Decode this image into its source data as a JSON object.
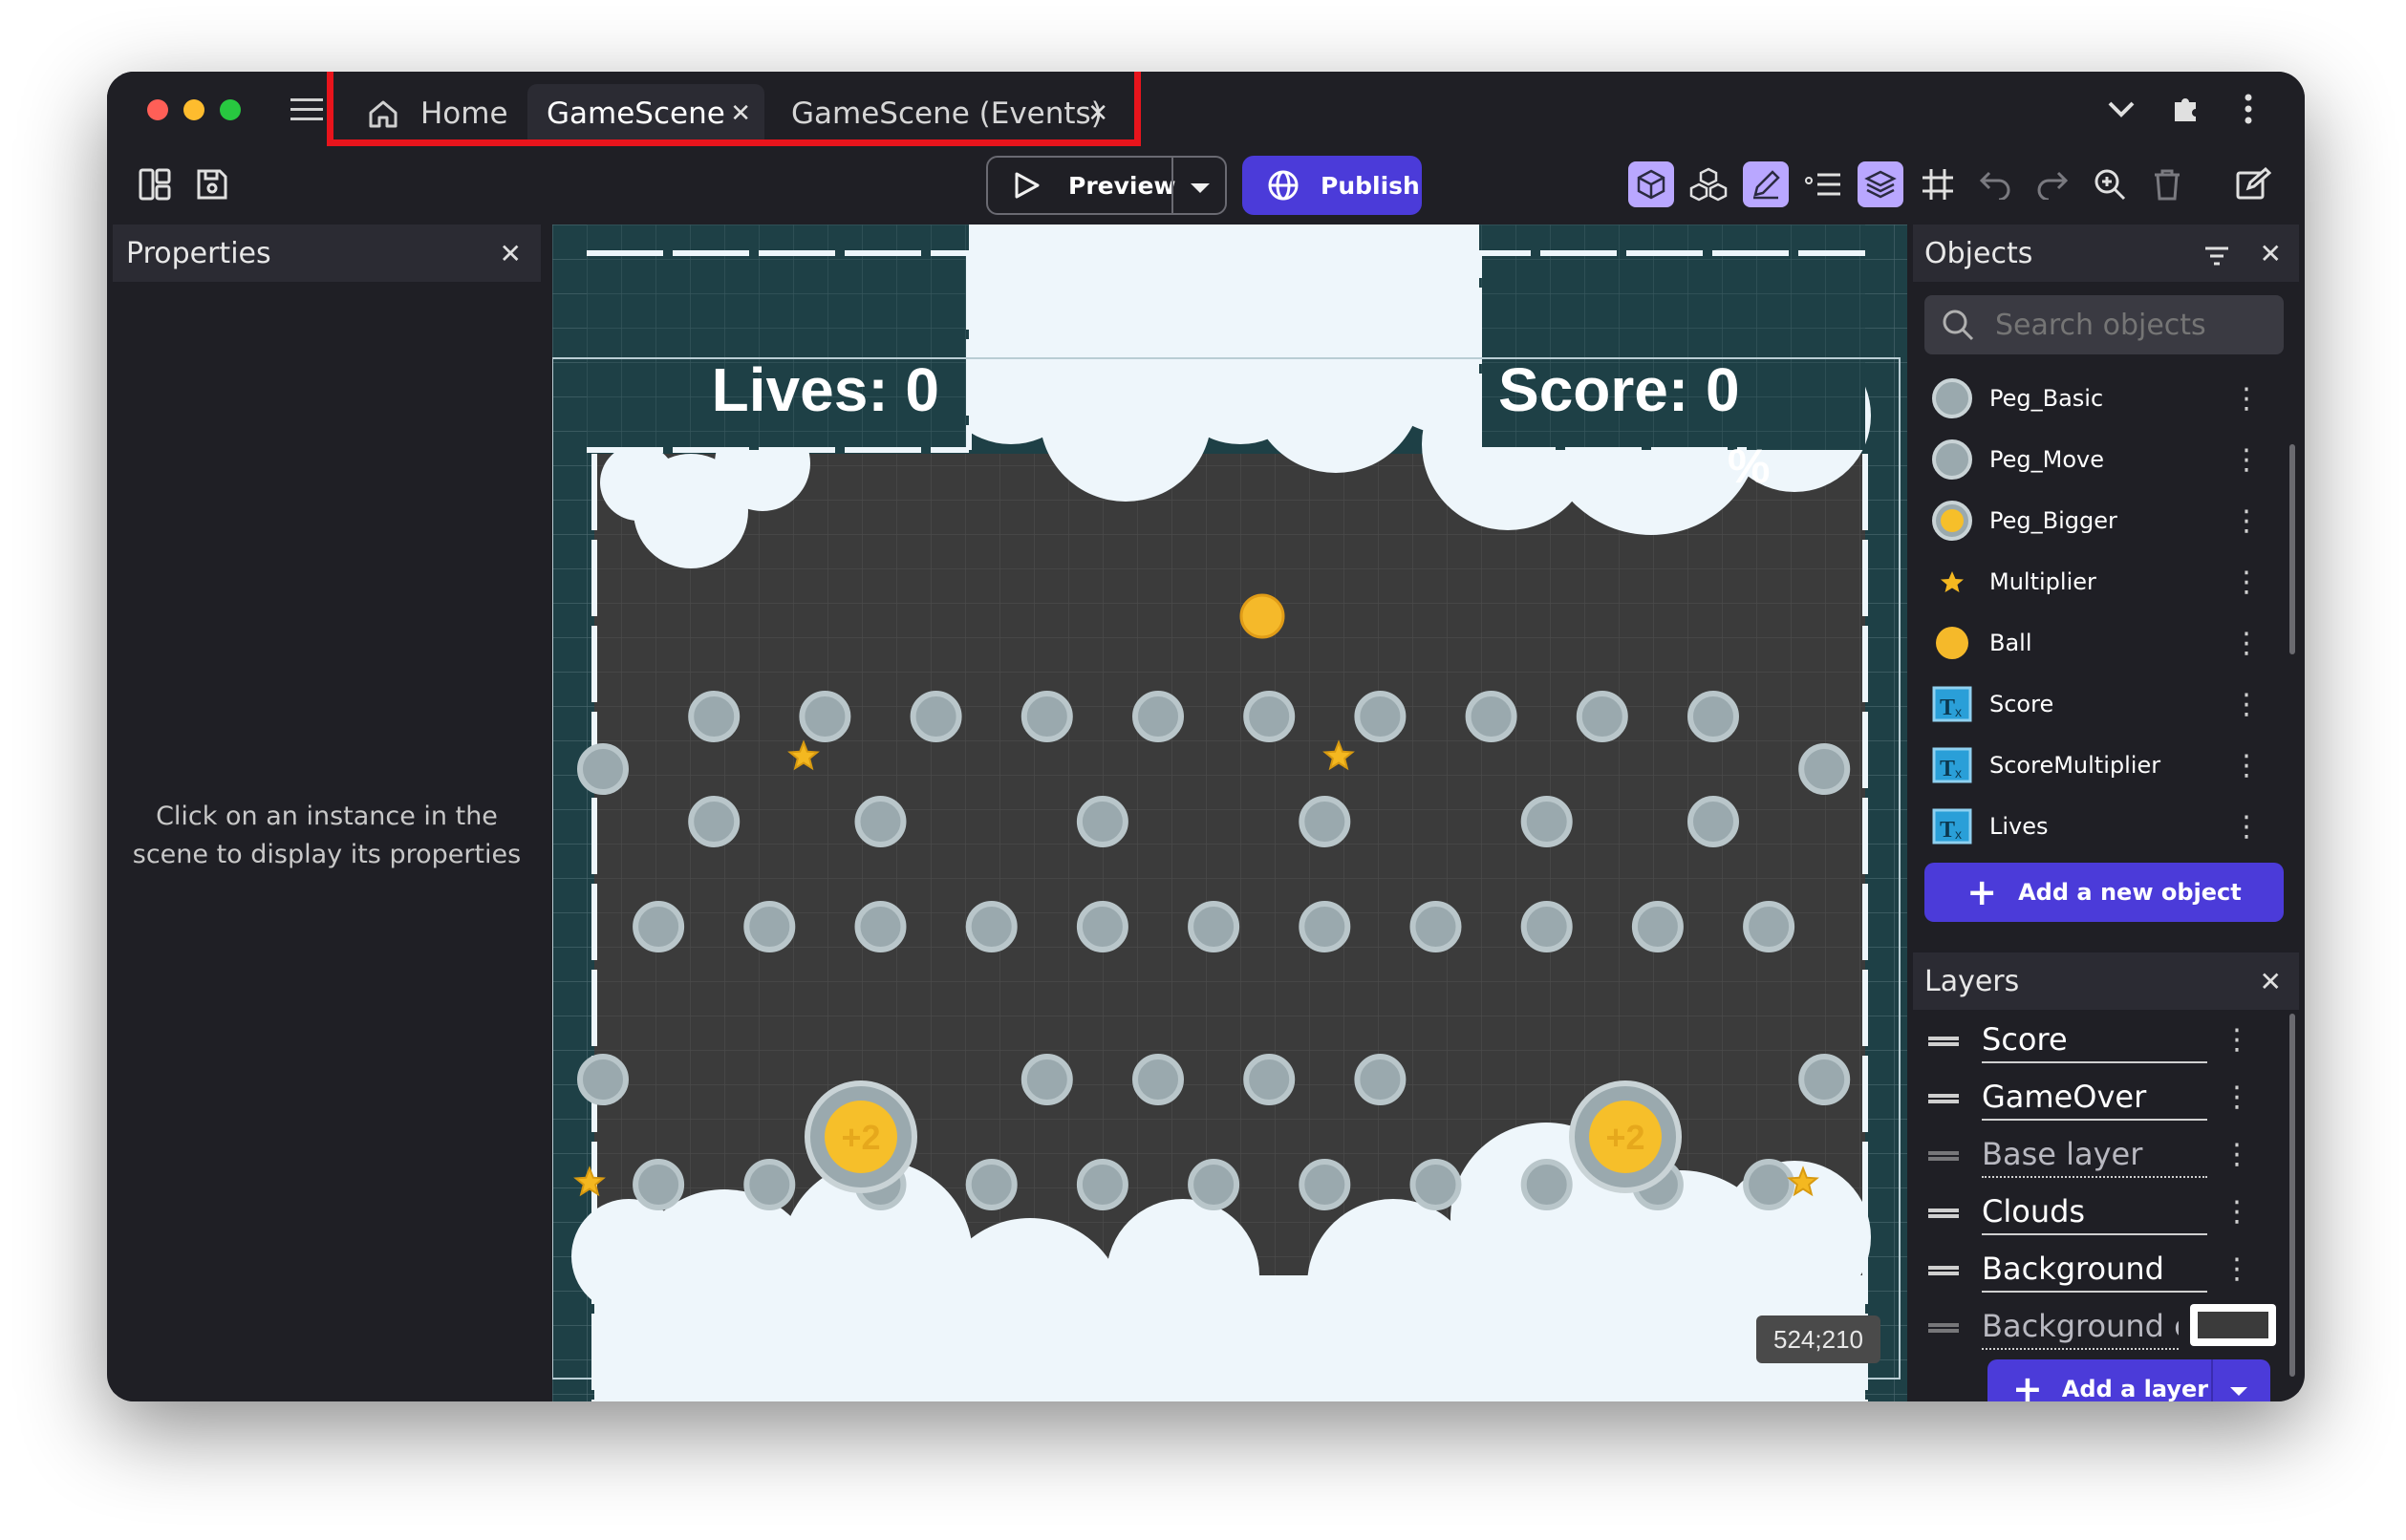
{
  "window": {
    "tabs": [
      {
        "label": "Home"
      },
      {
        "label": "GameScene"
      },
      {
        "label": "GameScene (Events)"
      }
    ],
    "close_glyph": "✕"
  },
  "toolbar": {
    "preview_label": "Preview",
    "publish_label": "Publish"
  },
  "properties": {
    "title": "Properties",
    "empty_line1": "Click on an instance in the",
    "empty_line2": "scene to display its properties"
  },
  "scene": {
    "lives_text": "Lives: 0",
    "score_text": "Score: 0",
    "multiplier_text": "%",
    "bonus_text": "+2",
    "coordinates": "524;210"
  },
  "objects": {
    "title": "Objects",
    "search_placeholder": "Search objects",
    "items": [
      {
        "name": "Peg_Basic",
        "icon": "gray-peg-icon"
      },
      {
        "name": "Peg_Move",
        "icon": "gray-peg-icon"
      },
      {
        "name": "Peg_Bigger",
        "icon": "gold-peg-icon"
      },
      {
        "name": "Multiplier",
        "icon": "star-icon"
      },
      {
        "name": "Ball",
        "icon": "ball-icon"
      },
      {
        "name": "Score",
        "icon": "text-object-icon"
      },
      {
        "name": "ScoreMultiplier",
        "icon": "text-object-icon"
      },
      {
        "name": "Lives",
        "icon": "text-object-icon"
      }
    ],
    "add_label": "Add a new object"
  },
  "layers": {
    "title": "Layers",
    "items": [
      {
        "name": "Score"
      },
      {
        "name": "GameOver"
      },
      {
        "name": "Base layer"
      },
      {
        "name": "Clouds"
      },
      {
        "name": "Background"
      },
      {
        "name": "Background cc"
      }
    ],
    "add_label": "Add a layer"
  },
  "colors": {
    "accent": "#4b3bd9",
    "highlight_red": "#e8141c",
    "scene_bg": "#3b3b3b",
    "board_frame": "#1e4046",
    "window_bg": "#1f1f25"
  }
}
